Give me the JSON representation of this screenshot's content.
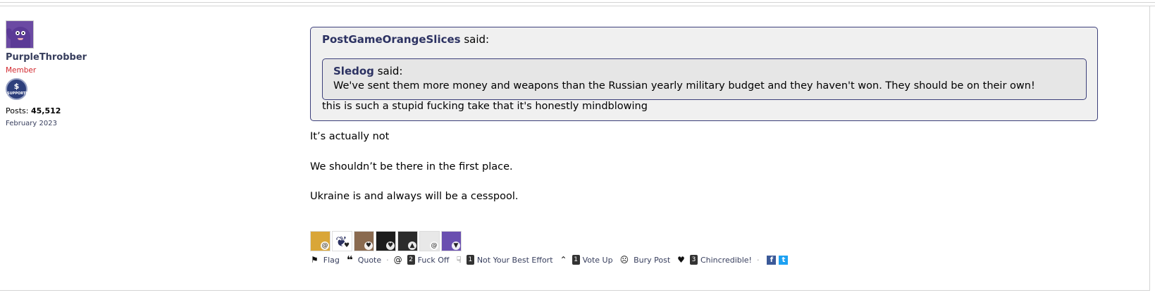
{
  "user": {
    "name": "PurpleThrobber",
    "role": "Member",
    "badge_text": "SUPPORTER",
    "posts_label": "Posts:",
    "posts_count": "45,512",
    "joined": "February 2023"
  },
  "quote_outer": {
    "author": "PostGameOrangeSlices",
    "said": "said:",
    "nested": {
      "author": "Sledog",
      "said": "said:",
      "text": "We've sent them more money and weapons than the Russian yearly military budget and they haven't won. They should be on their own!"
    },
    "text": "this is such a stupid fucking take that it's honestly mindblowing"
  },
  "post_body": [
    "It’s actually not",
    "We shouldn’t be there in the first place.",
    "Ukraine is and always will be a cesspool."
  ],
  "reactors": [
    {
      "color": "#d9a638",
      "icon": "swirl-icon"
    },
    {
      "color": "#ffffff",
      "icon": "paw-icon"
    },
    {
      "color": "#8a6a4f",
      "icon": "heart-icon"
    },
    {
      "color": "#1c1c1c",
      "icon": "heart-icon"
    },
    {
      "color": "#2b2b2b",
      "icon": "arrow-up-icon"
    },
    {
      "color": "#e8e8e8",
      "icon": "swirl-icon"
    },
    {
      "color": "#6a4fb0",
      "icon": "thumbs-down-icon"
    }
  ],
  "actions": {
    "flag": "Flag",
    "quote": "Quote",
    "fuck_off_count": "2",
    "fuck_off": "Fuck Off",
    "not_best_count": "1",
    "not_best": "Not Your Best Effort",
    "vote_up_count": "1",
    "vote_up": "Vote Up",
    "bury": "Bury Post",
    "chincredible_count": "3",
    "chincredible": "Chincredible!",
    "separator": "·",
    "facebook_glyph": "f",
    "twitter_glyph": "t"
  }
}
